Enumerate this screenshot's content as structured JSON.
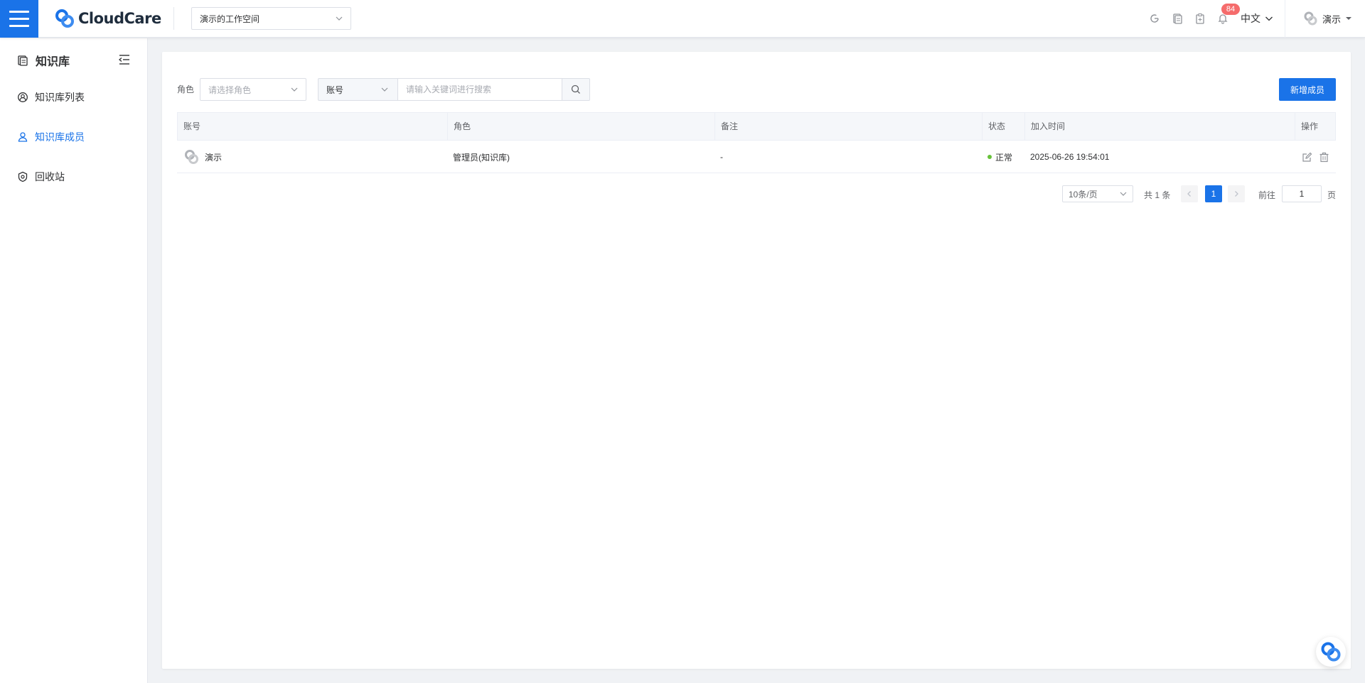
{
  "header": {
    "logo_text": "CloudCare",
    "workspace": "演示的工作空间",
    "notification_count": "84",
    "language": "中文",
    "user_name": "演示"
  },
  "sidebar": {
    "title": "知识库",
    "items": [
      {
        "label": "知识库列表",
        "icon": "user-circle-icon"
      },
      {
        "label": "知识库成员",
        "icon": "members-icon"
      },
      {
        "label": "回收站",
        "icon": "recycle-icon"
      }
    ],
    "active_index": 1
  },
  "filters": {
    "role_label": "角色",
    "role_placeholder": "请选择角色",
    "field_selected": "账号",
    "keyword_placeholder": "请输入关键词进行搜索",
    "add_button": "新增成员"
  },
  "table": {
    "columns": [
      "账号",
      "角色",
      "备注",
      "状态",
      "加入时间",
      "操作"
    ],
    "rows": [
      {
        "account": "演示",
        "role": "管理员(知识库)",
        "remark": "-",
        "status": "正常",
        "joined": "2025-06-26 19:54:01"
      }
    ]
  },
  "pagination": {
    "page_size": "10条/页",
    "total": "共 1 条",
    "current_page": "1",
    "goto_label": "前往",
    "goto_value": "1",
    "page_unit": "页"
  },
  "colors": {
    "primary": "#1a73e8",
    "status_ok": "#67c23a",
    "badge": "#f56c6c"
  }
}
